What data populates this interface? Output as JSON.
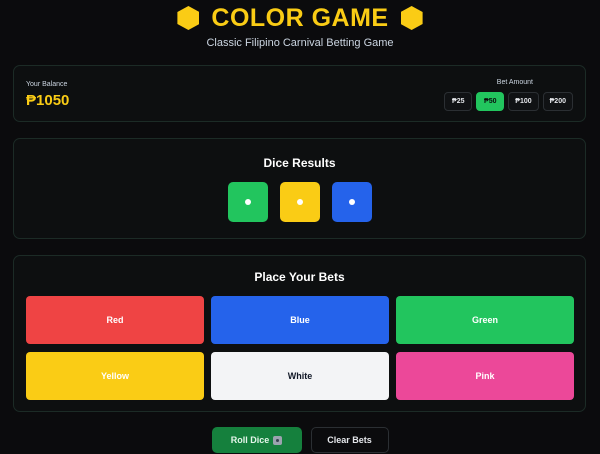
{
  "header": {
    "title": "COLOR GAME",
    "subtitle": "Classic Filipino Carnival Betting Game",
    "accent_color": "#facc15"
  },
  "balance": {
    "label": "Your Balance",
    "value": "₱1050"
  },
  "bet_amount": {
    "label": "Bet Amount",
    "options": [
      "₱25",
      "₱50",
      "₱100",
      "₱200"
    ],
    "selected": "₱50"
  },
  "dice": {
    "title": "Dice Results",
    "results": [
      {
        "color_name": "green",
        "color": "#22c55e"
      },
      {
        "color_name": "yellow",
        "color": "#facc15"
      },
      {
        "color_name": "blue",
        "color": "#2563eb"
      }
    ]
  },
  "bets": {
    "title": "Place Your Bets",
    "options": [
      {
        "label": "Red",
        "color": "#ef4444",
        "text_color": "#ffffff"
      },
      {
        "label": "Blue",
        "color": "#2563eb",
        "text_color": "#ffffff"
      },
      {
        "label": "Green",
        "color": "#22c55e",
        "text_color": "#ffffff"
      },
      {
        "label": "Yellow",
        "color": "#facc15",
        "text_color": "#ffffff"
      },
      {
        "label": "White",
        "color": "#f3f4f6",
        "text_color": "#111827"
      },
      {
        "label": "Pink",
        "color": "#ec4899",
        "text_color": "#ffffff"
      }
    ]
  },
  "actions": {
    "roll_label": "Roll Dice",
    "roll_icon": "dice-icon",
    "clear_label": "Clear Bets"
  }
}
